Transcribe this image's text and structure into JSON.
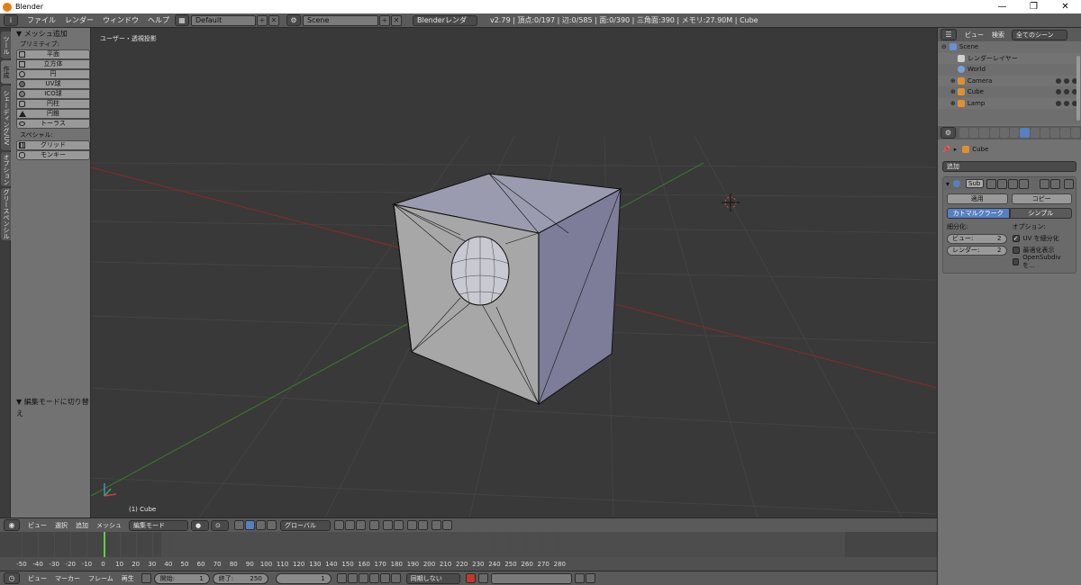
{
  "window": {
    "title": "Blender",
    "minimize": "—",
    "maximize": "❐",
    "close": "✕"
  },
  "menubar": {
    "info_icon": "i",
    "menus": [
      "ファイル",
      "レンダー",
      "ウィンドウ",
      "ヘルプ"
    ],
    "layout": "Default",
    "scene": "Scene",
    "render_engine": "Blenderレンダー",
    "stats": "v2.79 | 頂点:0/197 | 辺:0/585 | 面:0/390 | 三角面:390 | メモリ:27.90M | Cube"
  },
  "left_tabs": [
    "ツール",
    "作成",
    "シェーディング/UV",
    "オプション",
    "グリースペンシル"
  ],
  "tool_shelf": {
    "panel_title": "▼ メッシュ追加",
    "primitive_label": "プリミティブ:",
    "primitives": [
      "平面",
      "立方体",
      "円",
      "UV球",
      "ICO球",
      "円柱",
      "円錐",
      "トーラス"
    ],
    "special_label": "スペシャル:",
    "specials": [
      "グリッド",
      "モンキー"
    ],
    "operator_panel": "▼ 編集モードに切り替え"
  },
  "viewport": {
    "view_label": "ユーザー・透視投影",
    "object_label": "(1) Cube"
  },
  "viewport_header": {
    "menus": [
      "ビュー",
      "選択",
      "追加",
      "メッシュ"
    ],
    "mode": "編集モード",
    "orientation": "グローバル"
  },
  "timeline": {
    "ticks": [
      -50,
      -40,
      -30,
      -20,
      -10,
      0,
      10,
      20,
      30,
      40,
      50,
      60,
      70,
      80,
      90,
      100,
      110,
      120,
      130,
      140,
      150,
      160,
      170,
      180,
      190,
      200,
      210,
      220,
      230,
      240,
      250,
      260,
      270,
      280
    ],
    "current_frame": 1,
    "menus": [
      "ビュー",
      "マーカー",
      "フレーム",
      "再生"
    ],
    "start_label": "開始:",
    "start_value": "1",
    "end_label": "終了:",
    "end_value": "250",
    "frame_value": "1",
    "sync": "同期しない"
  },
  "outliner": {
    "menus": [
      "ビュー",
      "検索"
    ],
    "filter": "全てのシーン",
    "items": [
      {
        "label": "Scene",
        "color": "#6a8fd6"
      },
      {
        "label": "レンダーレイヤー",
        "color": "#d0d0d0"
      },
      {
        "label": "World",
        "color": "#7aa0d8"
      },
      {
        "label": "Camera",
        "color": "#e09030"
      },
      {
        "label": "Cube",
        "color": "#e09030"
      },
      {
        "label": "Lamp",
        "color": "#e09030"
      }
    ]
  },
  "properties": {
    "object": "Cube",
    "add_modifier": "追加",
    "modifier_name": "Sub",
    "apply": "適用",
    "copy": "コピー",
    "mode_catmull": "カトマルクラーク",
    "mode_simple": "シンプル",
    "subdivisions_label": "細分化:",
    "view_label": "ビュー:",
    "view_value": "2",
    "render_label": "レンダー:",
    "render_value": "2",
    "options_label": "オプション:",
    "opt_uv": "UV を細分化",
    "opt_optimal": "最適化表示",
    "opt_opensubdiv": "OpenSubdiv を..."
  }
}
